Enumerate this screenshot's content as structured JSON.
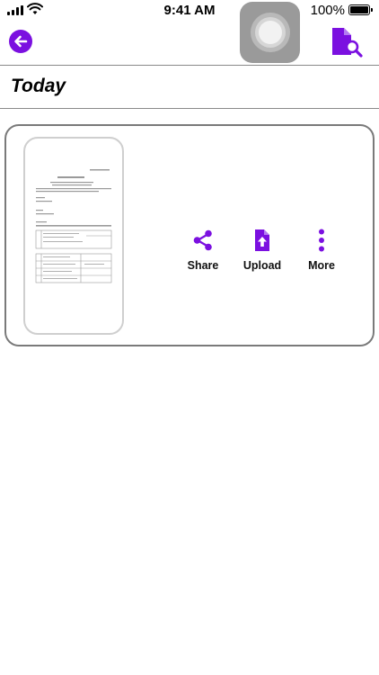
{
  "status": {
    "time": "9:41 AM",
    "battery": "100%"
  },
  "colors": {
    "accent": "#7b10e0"
  },
  "nav": {
    "back_icon": "arrow-left-circle-icon",
    "search_icon": "document-search-icon"
  },
  "section": {
    "title": "Today"
  },
  "document_card": {
    "actions": [
      {
        "label": "Share",
        "icon": "share-icon"
      },
      {
        "label": "Upload",
        "icon": "file-upload-icon"
      },
      {
        "label": "More",
        "icon": "more-vertical-icon"
      }
    ]
  }
}
